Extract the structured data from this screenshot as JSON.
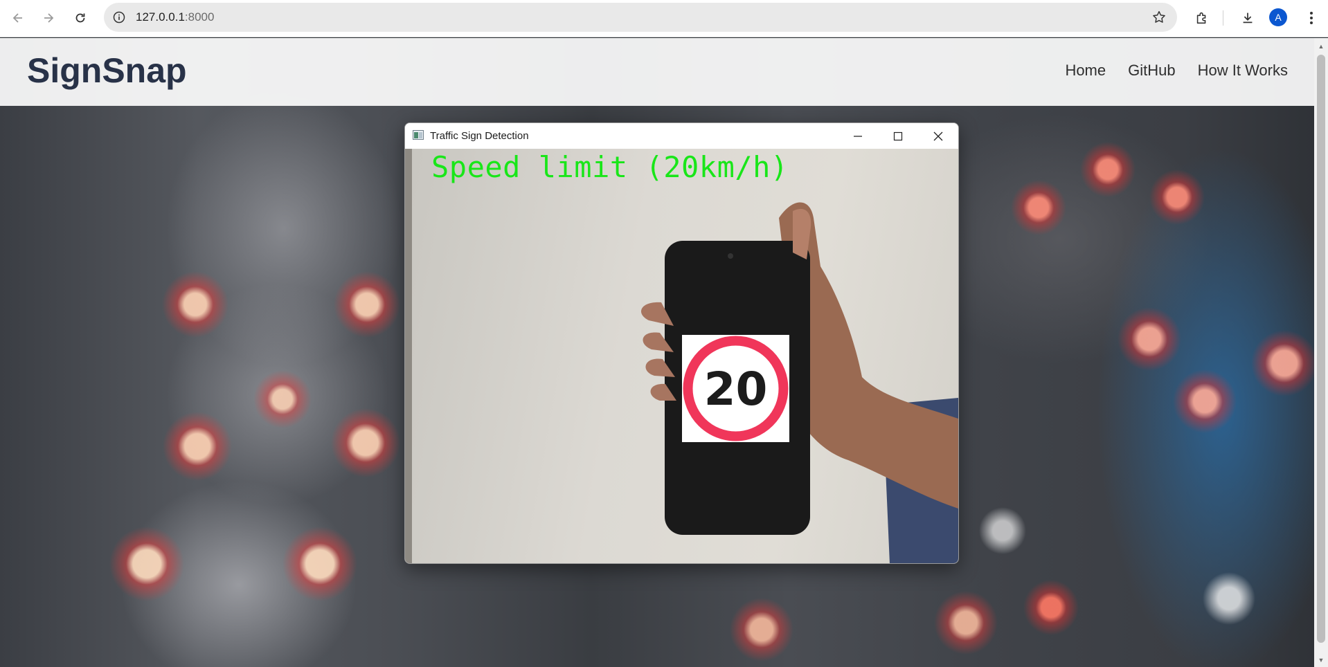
{
  "browser": {
    "url_host": "127.0.0.1",
    "url_port": ":8000",
    "profile_initial": "A"
  },
  "site": {
    "logo": "SignSnap",
    "nav": [
      "Home",
      "GitHub",
      "How It Works"
    ]
  },
  "window": {
    "title": "Traffic Sign Detection",
    "detection_label": "Speed limit (20km/h)",
    "sign_value": "20"
  },
  "colors": {
    "logo": "#283248",
    "detection_text": "#19e619",
    "sign_ring": "#f0365a",
    "avatar": "#0b57d0"
  }
}
